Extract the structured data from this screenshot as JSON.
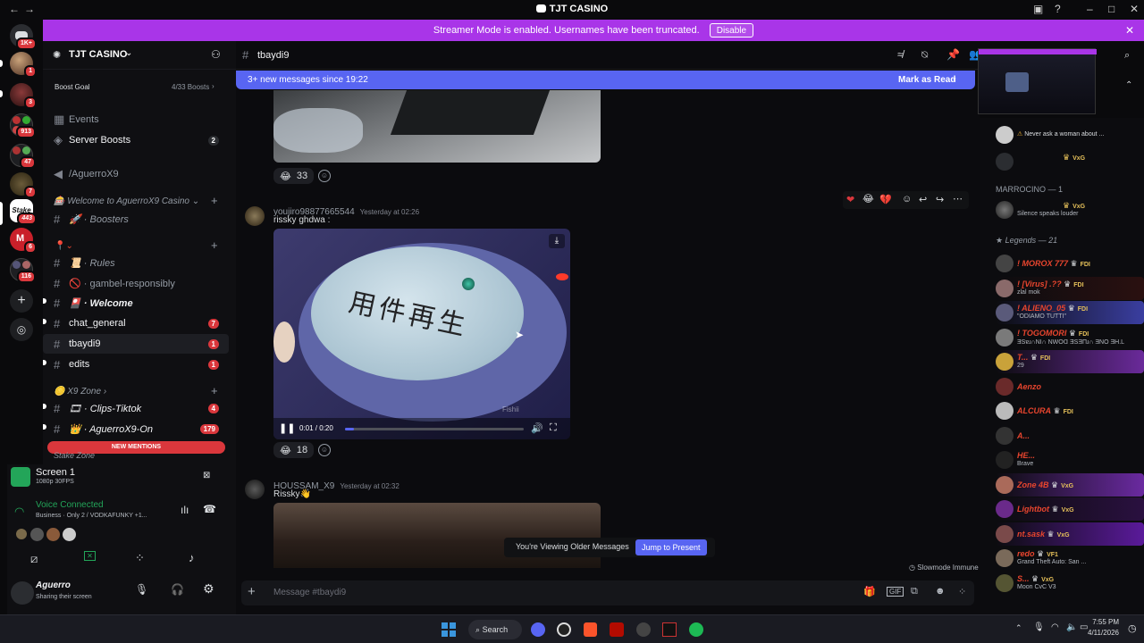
{
  "window": {
    "title": "TJT CASINO"
  },
  "banner": {
    "text": "Streamer Mode is enabled. Usernames have been truncated.",
    "disable_label": "Disable"
  },
  "rail": {
    "badges": [
      "1K+",
      "1",
      "3",
      "913",
      "47",
      "7",
      "443",
      "6",
      "116"
    ]
  },
  "server": {
    "name": "TJT CASINO",
    "boost_goal_label": "Boost Goal",
    "boost_progress": "4/33 Boosts",
    "events_label": "Events",
    "server_boosts_label": "Server Boosts",
    "server_boosts_count": "2",
    "channels": [
      {
        "name": "/AguerroX9"
      },
      {
        "category": "Welcome to AguerroX9 Casino"
      },
      {
        "name": "Boosters"
      },
      {
        "name": "Rules"
      },
      {
        "name": "gambel-responsibly"
      },
      {
        "name": "Welcome"
      },
      {
        "name": "chat_general",
        "badge": "7"
      },
      {
        "name": "tbaydi9",
        "badge": "1"
      },
      {
        "name": "edits",
        "badge": "1"
      },
      {
        "category": "X9 Zone"
      },
      {
        "name": "Clips-Tiktok",
        "badge": "4"
      },
      {
        "name": "AguerroX9-On",
        "badge": "179"
      },
      {
        "category": "Stake Zone"
      }
    ],
    "new_mentions_label": "NEW MENTIONS"
  },
  "stream": {
    "title": "Screen 1",
    "quality": "1080p 30FPS"
  },
  "voice": {
    "status": "Voice Connected",
    "detail": "Business · Only 2 / VODKAFUNKY +1..."
  },
  "user": {
    "name": "Aguerro",
    "status": "Sharing their screen"
  },
  "chat": {
    "channel": "tbaydi9",
    "new_messages": "3+ new messages since 19:22",
    "mark_as_read": "Mark as Read",
    "messages": [
      {
        "reaction_count": "33"
      },
      {
        "author": "youjiro98877665544",
        "timestamp": "Yesterday at 02:26",
        "text": "rissky ghdwa :",
        "video_time": "0:01 / 0:20",
        "video_progress": 0.05,
        "reaction_count": "18",
        "overlay_text": "用件再生",
        "watermark": "Fishii"
      },
      {
        "author": "HOUSSAM_X9",
        "timestamp": "Yesterday at 02:32",
        "text": "Rissky👋"
      }
    ],
    "older_notice": "You're Viewing Older Messages",
    "jump_label": "Jump to Present",
    "slowmode": "Slowmode Immune",
    "input_placeholder": "Message #tbaydi9"
  },
  "members": {
    "top_status": "Never ask a woman about ...",
    "groups": [
      {
        "title": "MARROCINO — 1"
      },
      {
        "title": "Legends — 21"
      }
    ],
    "marrocino_status": "Silence speaks louder",
    "list": [
      {
        "name": "! MOROX 777",
        "tag": "FDI",
        "color": "#e8452e",
        "status": ""
      },
      {
        "name": "! [Virus] .??",
        "tag": "FDI",
        "color": "#e8452e",
        "status": "zlal mok"
      },
      {
        "name": "! ALIENO_05",
        "tag": "FDI",
        "color": "#e8452e",
        "status": "\"ODIAMO TUTTI\""
      },
      {
        "name": "! TOGOMORI",
        "tag": "FDI",
        "color": "#e8452e",
        "status": "ƎSɐɹ∩NI∩ NWOᗡ ƎSƎΠɹ∩ ƎNO ƎH.L"
      },
      {
        "name": "T...",
        "tag": "FDI",
        "color": "#e8452e",
        "status": "29"
      },
      {
        "name": "Aenzo",
        "tag": "",
        "color": "#e8452e",
        "status": ""
      },
      {
        "name": "ALCURA",
        "tag": "FDI",
        "color": "#e8452e",
        "status": ""
      },
      {
        "name": "A...",
        "tag": "",
        "color": "#e8452e",
        "status": ""
      },
      {
        "name": "HE...",
        "tag": "",
        "color": "#e8452e",
        "status": "Brave"
      },
      {
        "name": "Zone 4B",
        "tag": "VxG",
        "color": "#e8452e",
        "status": ""
      },
      {
        "name": "Lightbot",
        "tag": "VxG",
        "color": "#e8452e",
        "status": ""
      },
      {
        "name": "nt.sask",
        "tag": "VxG",
        "color": "#e8452e",
        "status": ""
      },
      {
        "name": "redo",
        "tag": "VF1",
        "color": "#e8452e",
        "status": "Grand Theft Auto: San ..."
      },
      {
        "name": "S...",
        "tag": "VxG",
        "color": "#e8452e",
        "status": "Moon CvC V3"
      }
    ]
  },
  "taskbar": {
    "search_label": "Search",
    "time": "7:55 PM",
    "date": "4/11/2026"
  }
}
